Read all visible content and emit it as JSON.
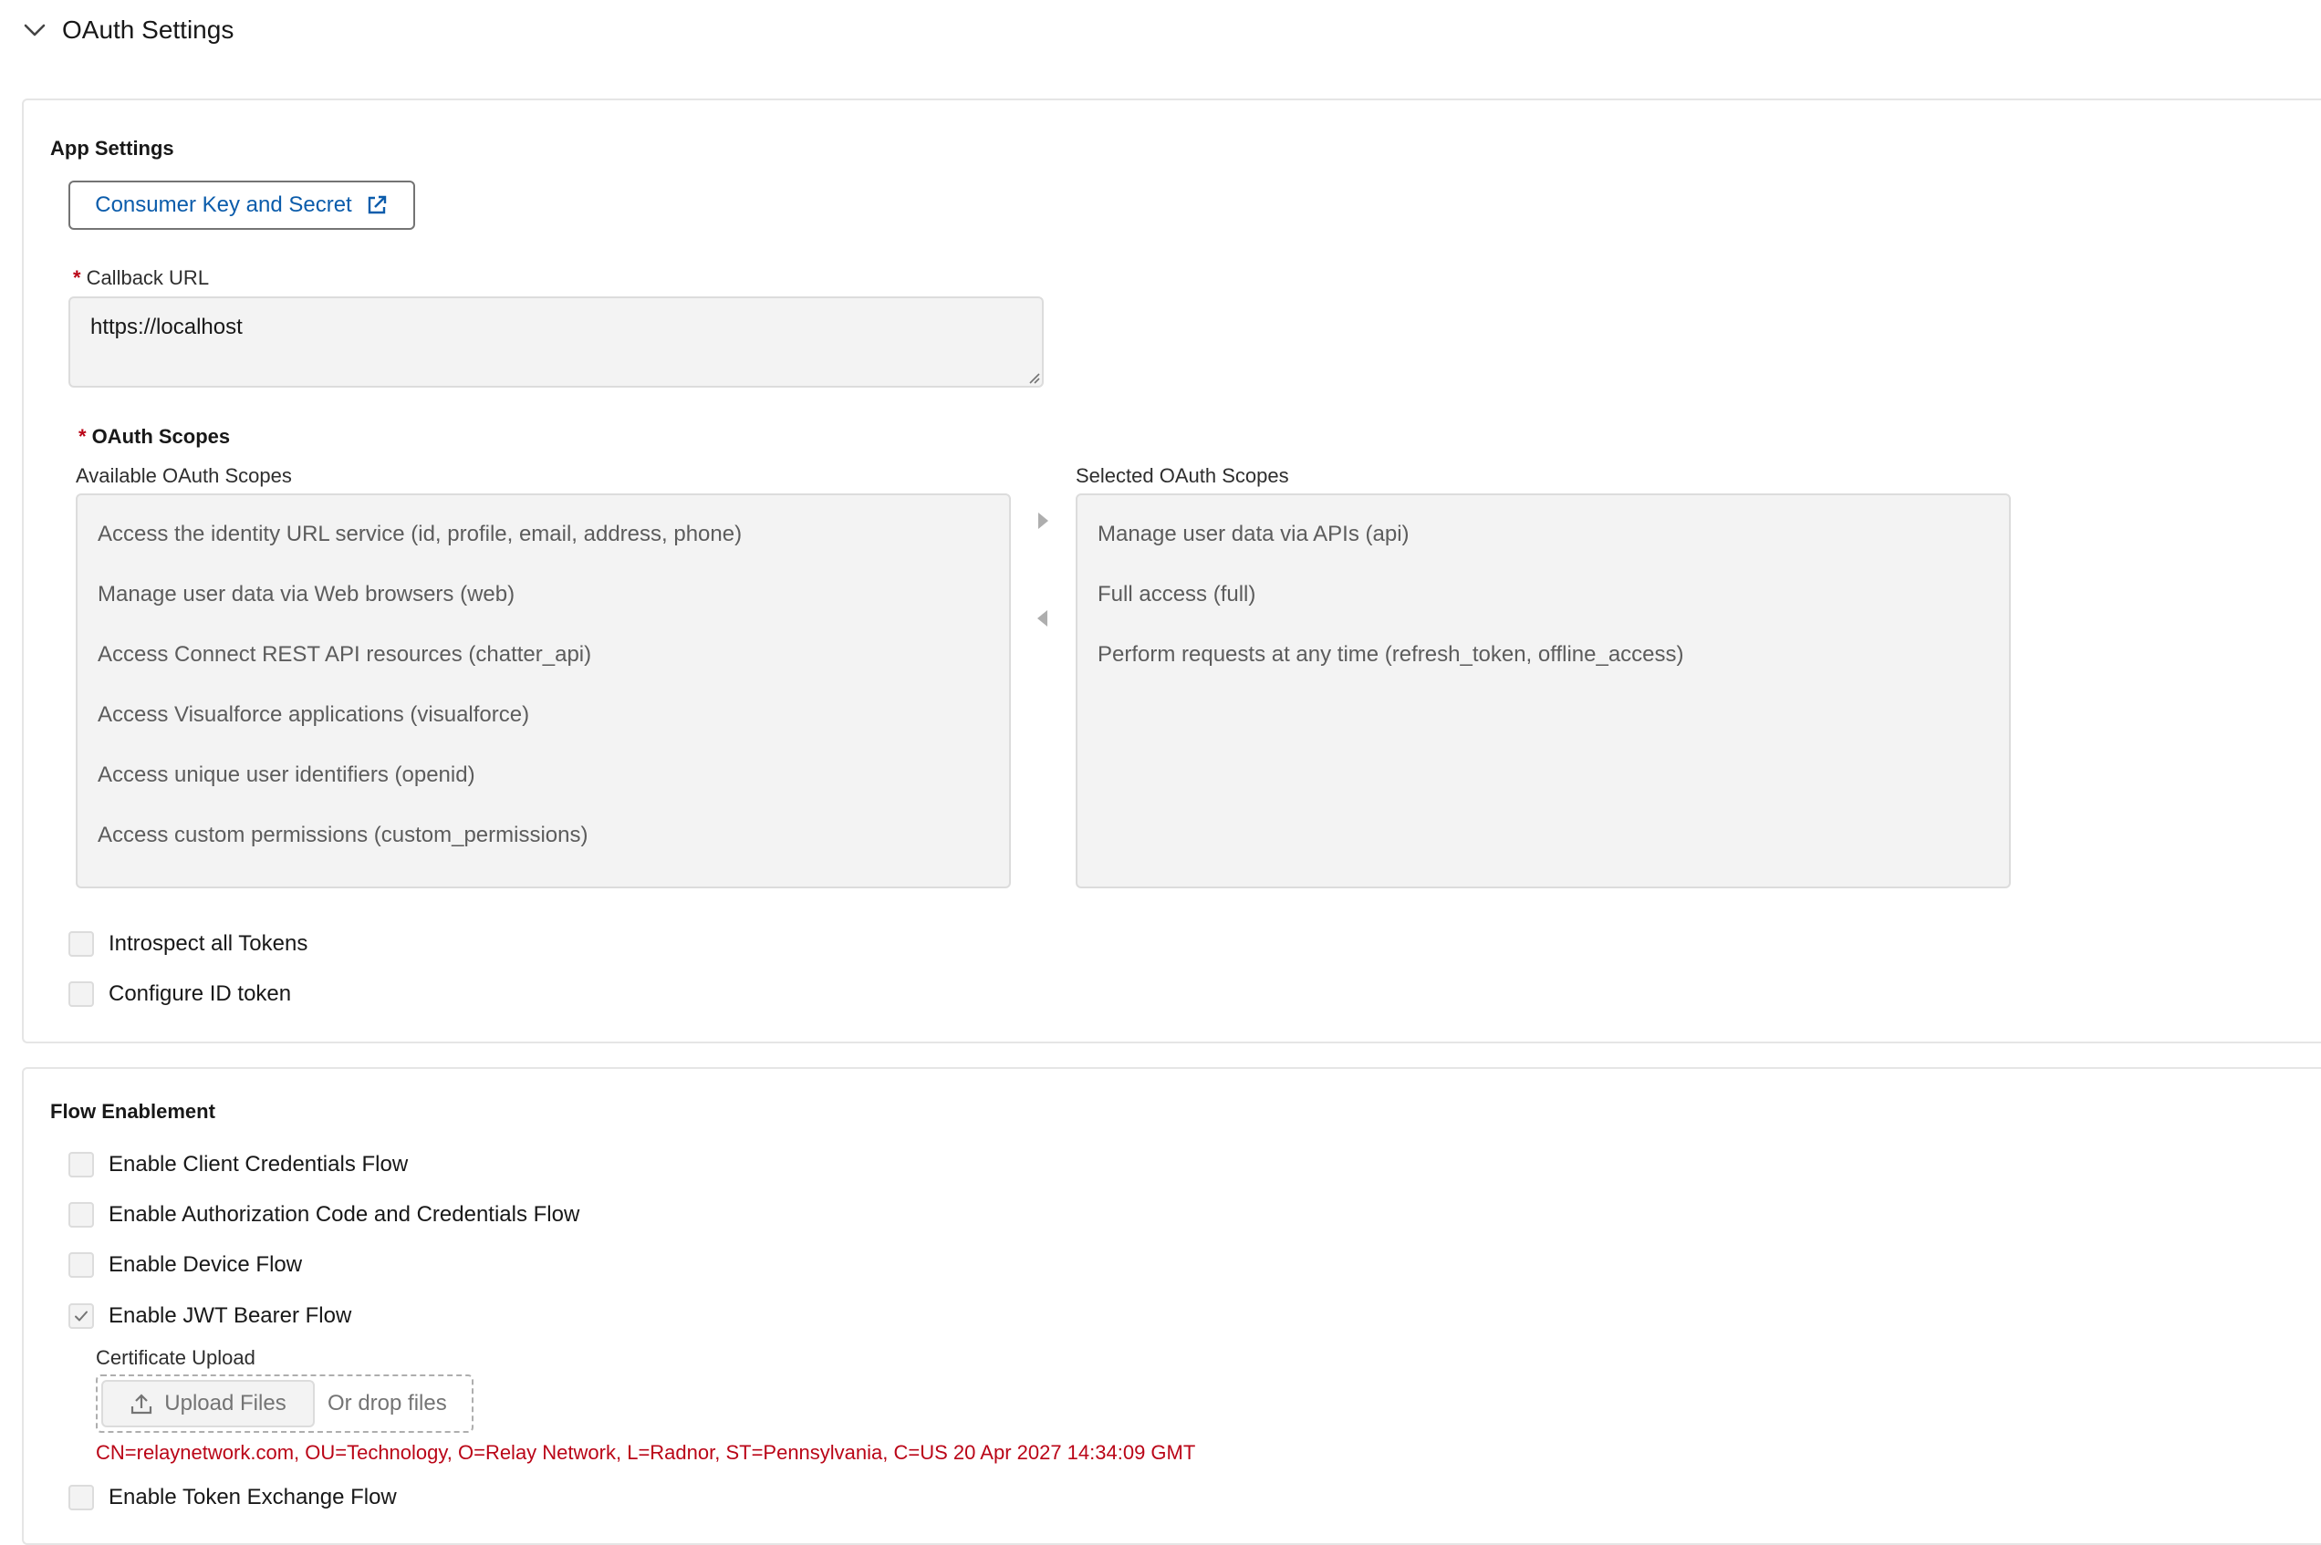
{
  "section": {
    "title": "OAuth Settings"
  },
  "app_settings": {
    "heading": "App Settings",
    "consumer_button": "Consumer Key and Secret",
    "callback_label": "Callback URL",
    "callback_value": "https://localhost",
    "scopes_label": "OAuth Scopes",
    "available_label": "Available OAuth Scopes",
    "selected_label": "Selected OAuth Scopes",
    "available_scopes": [
      "Access the identity URL service (id, profile, email, address, phone)",
      "Manage user data via Web browsers (web)",
      "Access Connect REST API resources (chatter_api)",
      "Access Visualforce applications (visualforce)",
      "Access unique user identifiers (openid)",
      "Access custom permissions (custom_permissions)"
    ],
    "selected_scopes": [
      "Manage user data via APIs (api)",
      "Full access (full)",
      "Perform requests at any time (refresh_token, offline_access)"
    ],
    "checkboxes": [
      {
        "label": "Introspect all Tokens",
        "checked": false
      },
      {
        "label": "Configure ID token",
        "checked": false
      }
    ]
  },
  "flow": {
    "heading": "Flow Enablement",
    "options": [
      {
        "label": "Enable Client Credentials Flow",
        "checked": false
      },
      {
        "label": "Enable Authorization Code and Credentials Flow",
        "checked": false
      },
      {
        "label": "Enable Device Flow",
        "checked": false
      },
      {
        "label": "Enable JWT Bearer Flow",
        "checked": true
      }
    ],
    "certificate_label": "Certificate Upload",
    "upload_button": "Upload Files",
    "drop_text": "Or drop files",
    "certificate_info": "CN=relaynetwork.com, OU=Technology, O=Relay Network, L=Radnor, ST=Pennsylvania, C=US 20 Apr 2027 14:34:09 GMT",
    "token_exchange": {
      "label": "Enable Token Exchange Flow",
      "checked": false
    }
  },
  "colors": {
    "link": "#0b5cab",
    "required": "#ba0517",
    "error_text": "#ba0517"
  }
}
